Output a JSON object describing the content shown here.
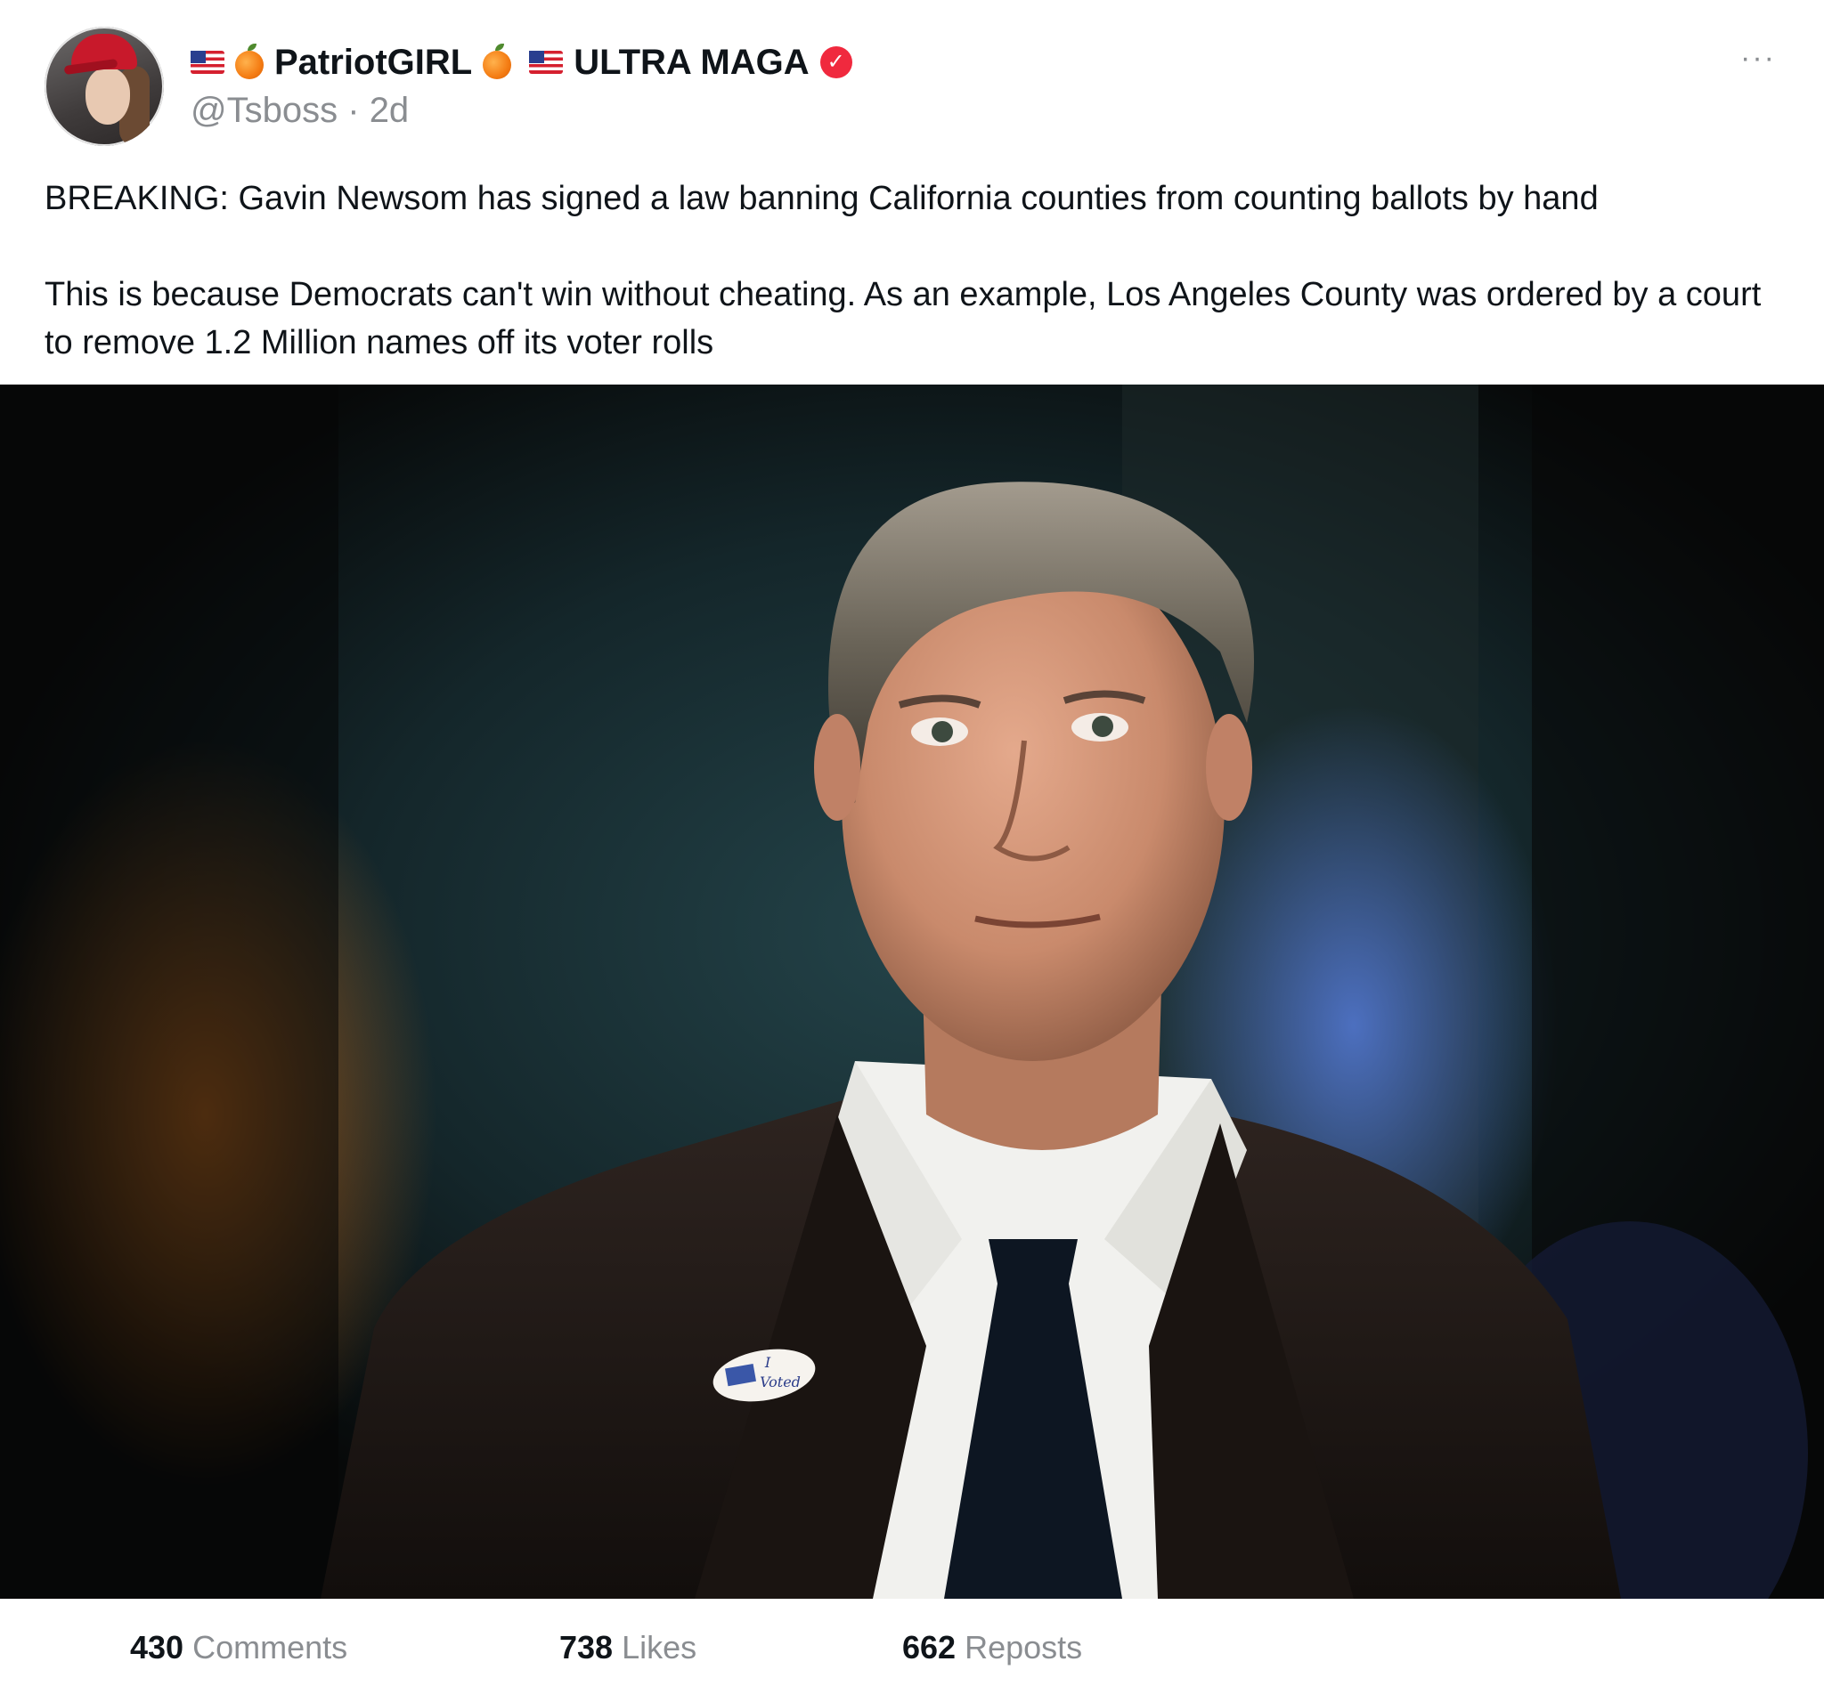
{
  "post": {
    "author": {
      "display_name_part1": "PatriotGIRL",
      "display_name_part2": "ULTRA MAGA",
      "handle": "@Tsboss",
      "separator": "·",
      "time": "2d"
    },
    "more_label": "···",
    "verified_glyph": "✓",
    "text": {
      "paragraph1": "BREAKING: Gavin Newsom has signed a law banning California counties from counting ballots by hand",
      "paragraph2": "This is because Democrats can't win without cheating. As an example, Los Angeles County was ordered by a court to remove 1.2 Million names off its voter rolls"
    },
    "image": {
      "sticker_line1": "I",
      "sticker_line2": "Voted"
    },
    "stats": {
      "comments_count": "430",
      "comments_label": "Comments",
      "likes_count": "738",
      "likes_label": "Likes",
      "reposts_count": "662",
      "reposts_label": "Reposts"
    }
  },
  "icons": {
    "flag": "us-flag-emoji-icon",
    "peach": "peach-emoji-icon",
    "verified": "verified-badge-icon",
    "more": "more-options-icon"
  },
  "colors": {
    "verified_badge": "#f0293e",
    "secondary_text": "#8a8d91",
    "primary_text": "#0f1419"
  }
}
